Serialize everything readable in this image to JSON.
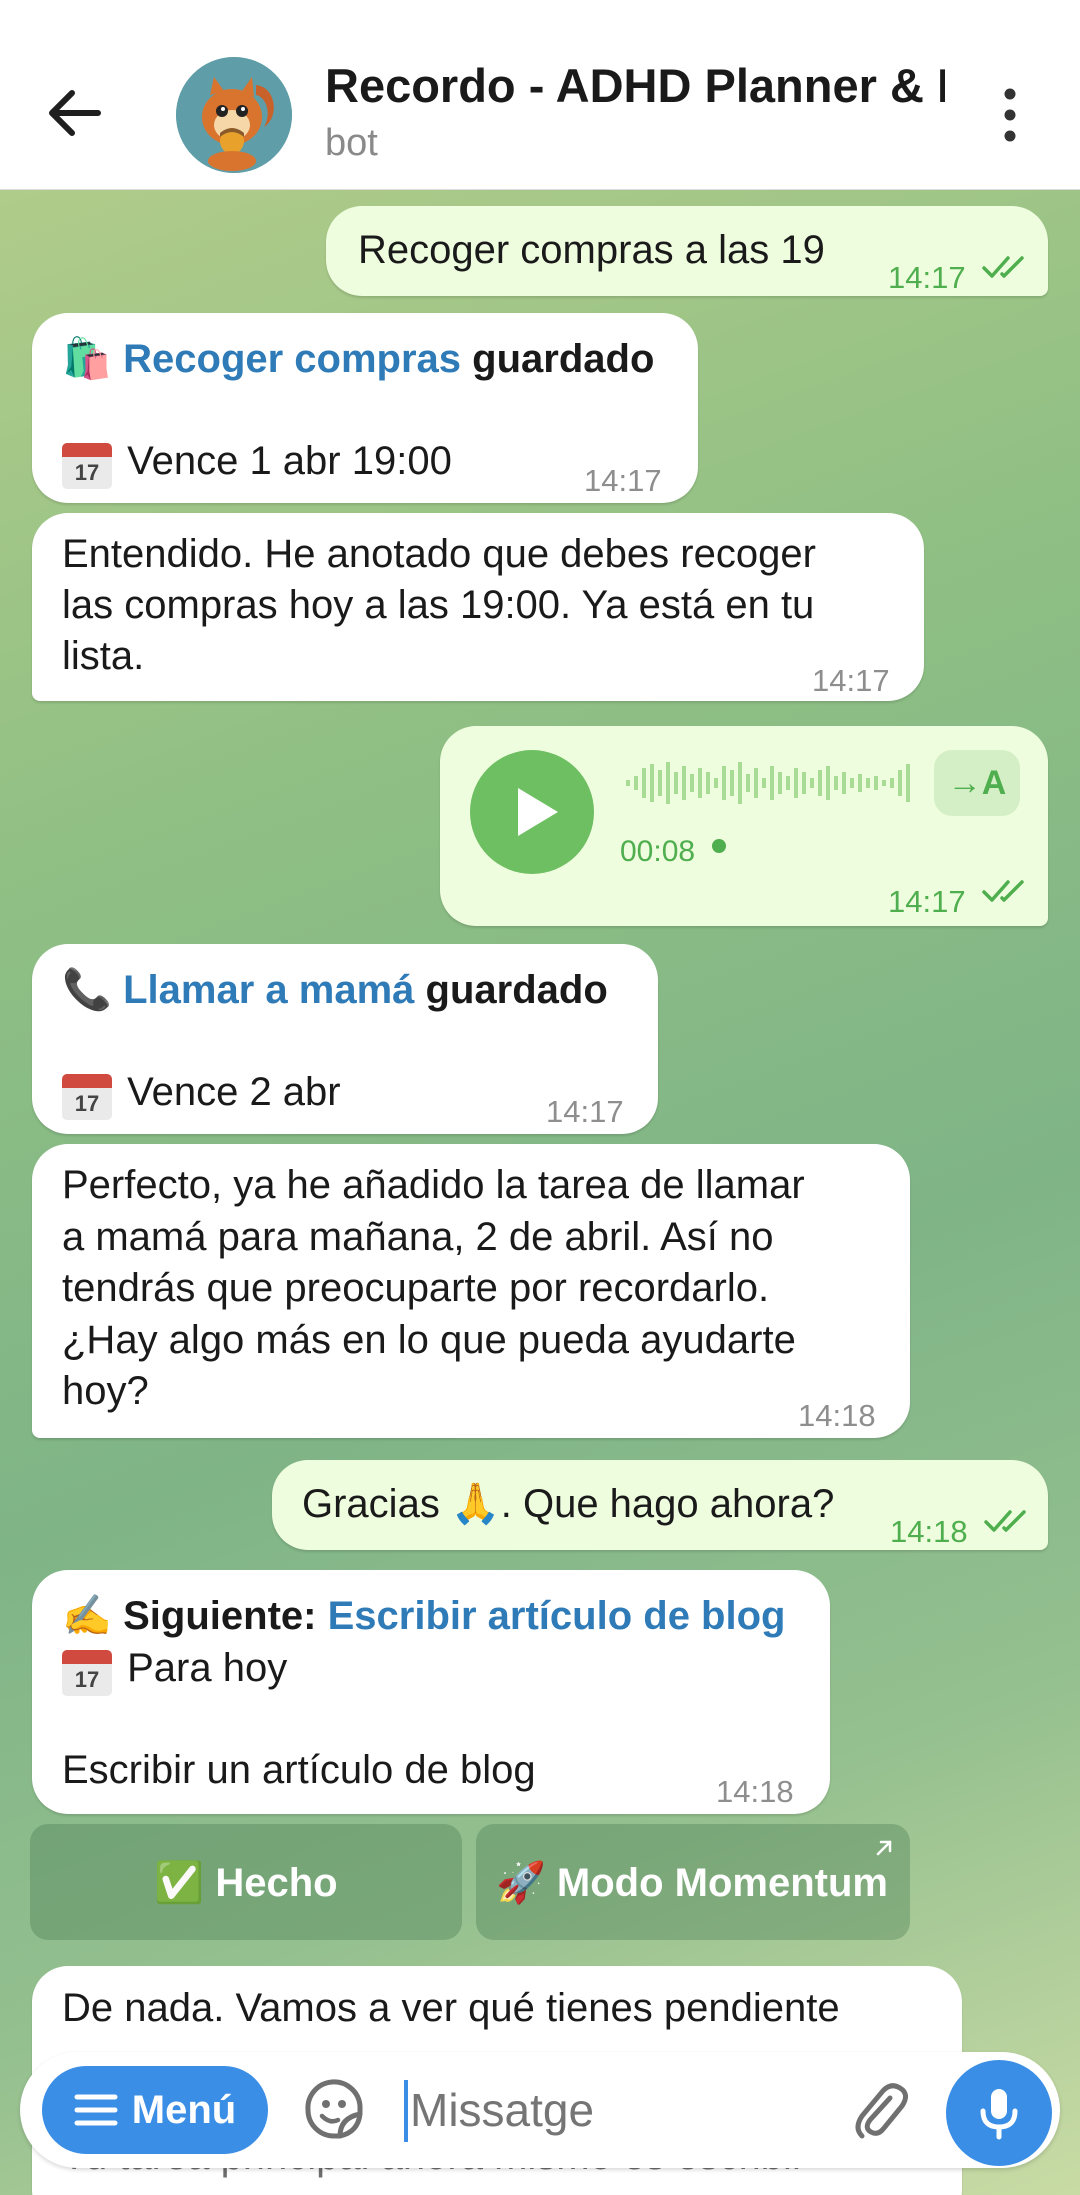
{
  "header": {
    "title": "Recordo - ADHD Planner & Memo",
    "subtitle": "bot"
  },
  "messages": {
    "m1": {
      "text": "Recoger compras a las 19",
      "time": "14:17"
    },
    "m2": {
      "emoji": "🛍️",
      "link": "Recoger compras",
      "suffix": "guardado",
      "due": "Vence 1 abr 19:00",
      "time": "14:17"
    },
    "m3": {
      "lines": [
        "Entendido. He anotado que debes recoger",
        "las compras hoy a las 19:00. Ya está en tu",
        "lista."
      ],
      "time": "14:17"
    },
    "m4": {
      "duration": "00:08",
      "transcribe_label": "→A",
      "time": "14:17"
    },
    "m5": {
      "emoji": "📞",
      "link": "Llamar a mamá",
      "suffix": "guardado",
      "due": "Vence 2 abr",
      "time": "14:17"
    },
    "m6": {
      "lines": [
        "Perfecto, ya he añadido la tarea de llamar",
        "a mamá para mañana, 2 de abril. Así no",
        "tendrás que preocuparte por recordarlo.",
        "¿Hay algo más en lo que pueda ayudarte",
        "hoy?"
      ],
      "time": "14:18"
    },
    "m7": {
      "text": "Gracias 🙏. Que hago ahora?",
      "time": "14:18"
    },
    "m8": {
      "emoji": "✍️",
      "label": "Siguiente:",
      "link": "Escribir artículo de blog",
      "due": "Para hoy",
      "body": "Escribir un artículo de blog",
      "time": "14:18"
    },
    "m9": {
      "line1": "De nada. Vamos a ver qué tienes pendiente",
      "line2": "Tu tarea principal ahora mismo es escribir"
    }
  },
  "calendar_icon": {
    "month": "JUL",
    "day": "17"
  },
  "keyboard": {
    "done_label": "✅ Hecho",
    "momentum_label": "🚀 Modo Momentum"
  },
  "input": {
    "menu_label": "Menú",
    "placeholder": "Missatge"
  },
  "colors": {
    "accent": "#3a8ee6",
    "link": "#2f7bb8",
    "outgoing_bubble": "#effddf",
    "incoming_bubble": "#ffffff",
    "outgoing_time": "#4fae4e"
  }
}
